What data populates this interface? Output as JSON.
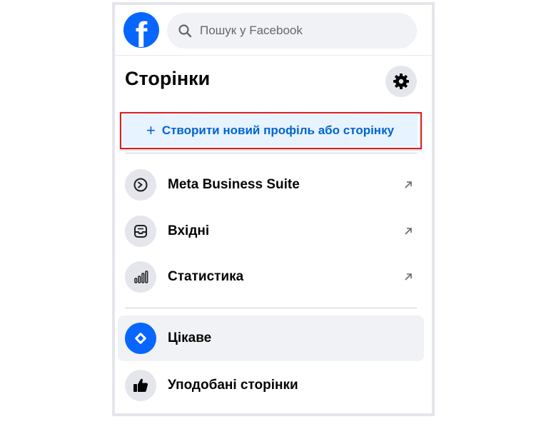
{
  "header": {
    "logo_letter": "f",
    "search_placeholder": "Пошук у Facebook"
  },
  "title": "Сторінки",
  "create_button": {
    "plus": "+",
    "label": "Створити новий профіль або сторінку"
  },
  "tools": [
    {
      "label": "Meta Business Suite",
      "icon": "meta-business-suite-icon"
    },
    {
      "label": "Вхідні",
      "icon": "inbox-icon"
    },
    {
      "label": "Статистика",
      "icon": "insights-icon"
    }
  ],
  "nav": [
    {
      "label": "Цікаве",
      "icon": "discover-compass-icon",
      "selected": true
    },
    {
      "label": "Уподобані сторінки",
      "icon": "thumbs-up-icon",
      "selected": false
    }
  ],
  "colors": {
    "brand_blue": "#0866ff",
    "link_blue": "#0064d1",
    "highlight_red": "#d81f26",
    "create_bg": "#e7f3ff"
  }
}
